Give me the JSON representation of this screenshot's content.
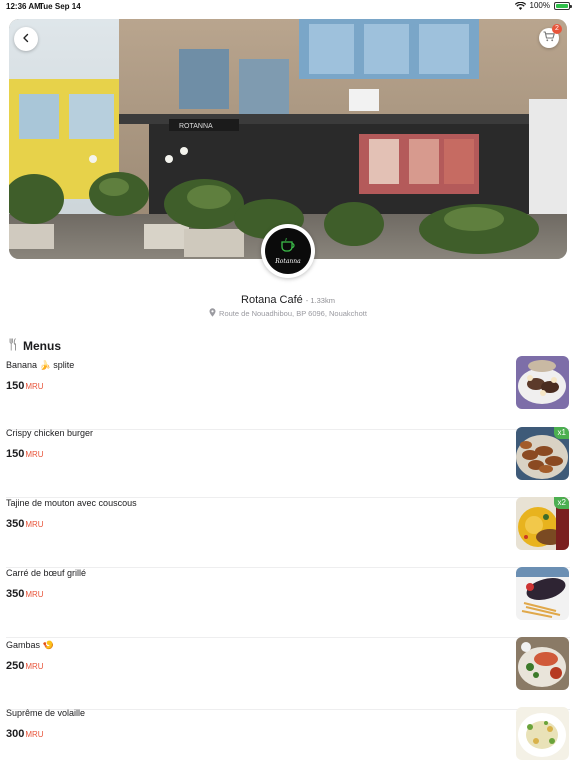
{
  "status_bar": {
    "time": "12:36 AM",
    "date": "Tue Sep 14",
    "battery": "100%"
  },
  "header": {
    "cart_count": "2"
  },
  "restaurant": {
    "name": "Rotana Café",
    "distance": "- 1.33km",
    "address": "Route de Nouadhibou, BP 6096, Nouakchott",
    "logo_text": "Rotanna"
  },
  "section": {
    "title": "Menus"
  },
  "menu_items": [
    {
      "name": "Banana 🍌 splite",
      "price": "150",
      "currency": "MRU",
      "qty": ""
    },
    {
      "name": "Crispy chicken burger",
      "price": "150",
      "currency": "MRU",
      "qty": "x1"
    },
    {
      "name": "Tajine de mouton avec couscous",
      "price": "350",
      "currency": "MRU",
      "qty": "x2"
    },
    {
      "name": "Carré de bœuf grillé",
      "price": "350",
      "currency": "MRU",
      "qty": ""
    },
    {
      "name": "Gambas 🍤",
      "price": "250",
      "currency": "MRU",
      "qty": ""
    },
    {
      "name": "Suprême de volaille",
      "price": "300",
      "currency": "MRU",
      "qty": ""
    }
  ],
  "colors": {
    "accent": "#e8553b",
    "badge_green": "#4caf50"
  },
  "icons": {
    "back": "chevron-left-icon",
    "cart": "cart-icon",
    "location": "location-pin-icon",
    "menu": "fork-knife-icon"
  }
}
